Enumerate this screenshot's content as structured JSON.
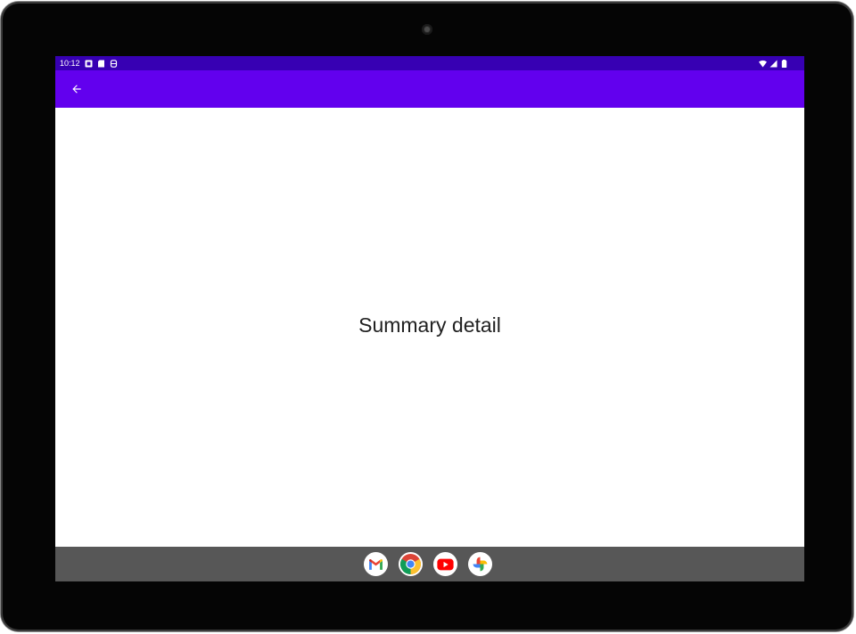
{
  "status_bar": {
    "time": "10:12",
    "left_icons": [
      "notification-icon",
      "sd-card-icon",
      "storage-icon"
    ],
    "right_icons": [
      "wifi-icon",
      "signal-icon",
      "battery-icon"
    ]
  },
  "app_bar": {
    "background": "#6200ee",
    "status_bar_color": "#3700b3",
    "back_icon": "arrow-back-icon"
  },
  "content": {
    "text": "Summary detail"
  },
  "taskbar": {
    "apps": [
      {
        "name": "Gmail",
        "icon": "gmail-icon"
      },
      {
        "name": "Chrome",
        "icon": "chrome-icon"
      },
      {
        "name": "YouTube",
        "icon": "youtube-icon"
      },
      {
        "name": "Photos",
        "icon": "photos-icon"
      }
    ]
  }
}
